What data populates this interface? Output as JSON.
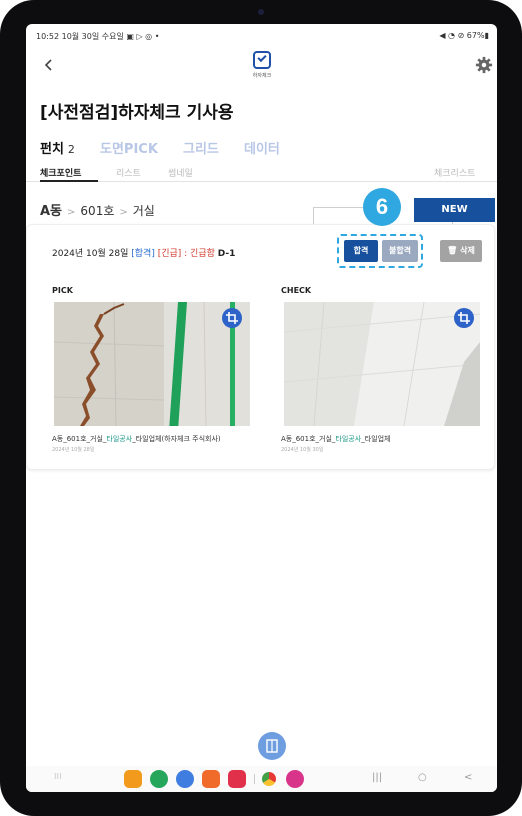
{
  "status_bar": {
    "left": "10:52  10월 30일 수요일  ▣ ▷ ◎ •",
    "right": "◀ ◔ ⊘ 67%▮"
  },
  "app": {
    "logo_text": "하자체크",
    "title": "[사전점검]하자체크 기사용"
  },
  "main_tabs": [
    {
      "label": "펀치",
      "count": "2"
    },
    {
      "label": "도면PICK"
    },
    {
      "label": "그리드"
    },
    {
      "label": "데이터"
    }
  ],
  "sub_tabs": {
    "items": [
      "체크포인트",
      "리스트",
      "썸네일"
    ],
    "right": "체크리스트"
  },
  "breadcrumb": {
    "building": "A동",
    "unit": "601호",
    "room": "거실"
  },
  "new_button": "NEW",
  "step_badge": "6",
  "card": {
    "date": "2024년 10월 28일",
    "status_tag": "[합격]",
    "urgent_tag": "[긴급] : 긴급함",
    "dday": "D-1",
    "pass_label": "합격",
    "fail_label": "불합격",
    "delete_label": "삭제",
    "pick": {
      "label": "PICK",
      "caption_prefix": "A동_601호_거실_",
      "caption_work": "타일공사",
      "caption_suffix": "_타일업체(하자체크 주식회사)",
      "date": "2024년 10월 28일"
    },
    "check": {
      "label": "CHECK",
      "caption_prefix": "A동_601호_거실_",
      "caption_work": "타일공사",
      "caption_suffix": "_타일업체",
      "date": "2024년 10월 30일"
    }
  },
  "nav": {
    "grid": "⁝⁝⁝",
    "recent": "|||",
    "home": "○",
    "back": "<"
  },
  "colors": {
    "brand_blue": "#17519e",
    "highlight": "#2fa7e0",
    "tab_inactive": "#b9c7e6",
    "urgent_red": "#d23a2e",
    "work_teal": "#1a9a88"
  }
}
